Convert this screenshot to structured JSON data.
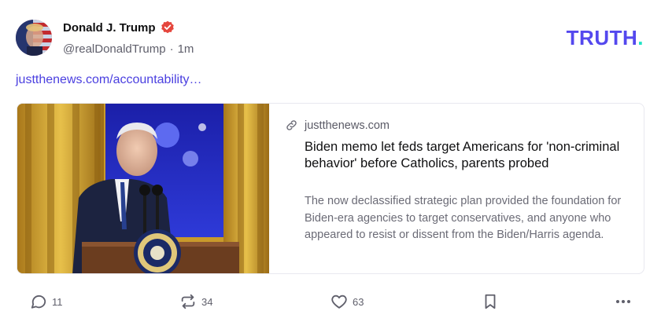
{
  "author": {
    "display_name": "Donald J. Trump",
    "handle": "@realDonaldTrump",
    "separator": "·",
    "time": "1m",
    "verified_icon": "verified-badge-icon",
    "verified_color": "#e5463d"
  },
  "brand": {
    "text": "TRUTH",
    "dot": ".",
    "color": "#5448ee",
    "dot_color": "#1fe3c6"
  },
  "status_link": "justthenews.com/accountability…",
  "link_card": {
    "domain": "justthenews.com",
    "domain_icon": "link-icon",
    "title": "Biden memo let feds target Americans for 'non-criminal behavior' before Catholics, parents probed",
    "description": "The now declassified strategic plan provided the foundation for Biden-era agencies to target conservatives, and anyone who appeared to resist or dissent from the Biden/Harris agenda.",
    "image": "photo of Joe Biden at podium with presidential seal"
  },
  "actions": {
    "reply": {
      "icon": "reply-icon",
      "count": "11"
    },
    "retruth": {
      "icon": "retruth-icon",
      "count": "34"
    },
    "like": {
      "icon": "heart-icon",
      "count": "63"
    },
    "bookmark": {
      "icon": "bookmark-icon"
    },
    "more": {
      "icon": "more-icon"
    }
  },
  "colors": {
    "link": "#4a3fe0",
    "muted": "#5f5f6b"
  }
}
